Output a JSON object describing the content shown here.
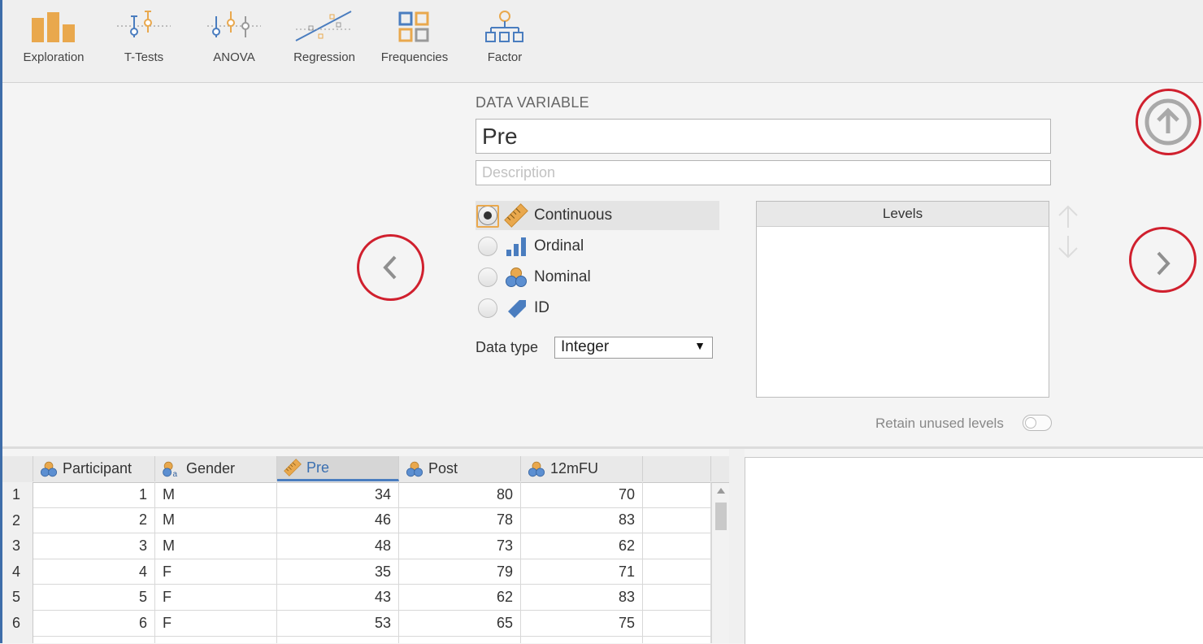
{
  "toolbar": {
    "items": [
      {
        "label": "Exploration",
        "icon": "bar-chart-icon"
      },
      {
        "label": "T-Tests",
        "icon": "t-tests-icon"
      },
      {
        "label": "ANOVA",
        "icon": "anova-icon"
      },
      {
        "label": "Regression",
        "icon": "regression-icon"
      },
      {
        "label": "Frequencies",
        "icon": "frequencies-icon"
      },
      {
        "label": "Factor",
        "icon": "factor-icon"
      }
    ]
  },
  "setup": {
    "title": "DATA VARIABLE",
    "name_value": "Pre",
    "description_placeholder": "Description",
    "measure_types": [
      {
        "label": "Continuous",
        "icon": "ruler-icon",
        "selected": true
      },
      {
        "label": "Ordinal",
        "icon": "ordinal-bars-icon",
        "selected": false
      },
      {
        "label": "Nominal",
        "icon": "nominal-circles-icon",
        "selected": false
      },
      {
        "label": "ID",
        "icon": "id-tag-icon",
        "selected": false
      }
    ],
    "data_type_label": "Data type",
    "data_type_value": "Integer",
    "levels_header": "Levels",
    "retain_label": "Retain unused levels"
  },
  "grid": {
    "columns": [
      "Participant",
      "Gender",
      "Pre",
      "Post",
      "12mFU"
    ],
    "selected_column": "Pre",
    "rows": [
      {
        "n": "1",
        "participant": "1",
        "gender": "M",
        "pre": "34",
        "post": "80",
        "fu": "70"
      },
      {
        "n": "2",
        "participant": "2",
        "gender": "M",
        "pre": "46",
        "post": "78",
        "fu": "83"
      },
      {
        "n": "3",
        "participant": "3",
        "gender": "M",
        "pre": "48",
        "post": "73",
        "fu": "62"
      },
      {
        "n": "4",
        "participant": "4",
        "gender": "F",
        "pre": "35",
        "post": "79",
        "fu": "71"
      },
      {
        "n": "5",
        "participant": "5",
        "gender": "F",
        "pre": "43",
        "post": "62",
        "fu": "83"
      },
      {
        "n": "6",
        "participant": "6",
        "gender": "F",
        "pre": "53",
        "post": "65",
        "fu": "75"
      }
    ]
  },
  "colors": {
    "accent_orange": "#e9a84d",
    "accent_blue": "#4a7dbf",
    "highlight_red": "#d0202e"
  }
}
